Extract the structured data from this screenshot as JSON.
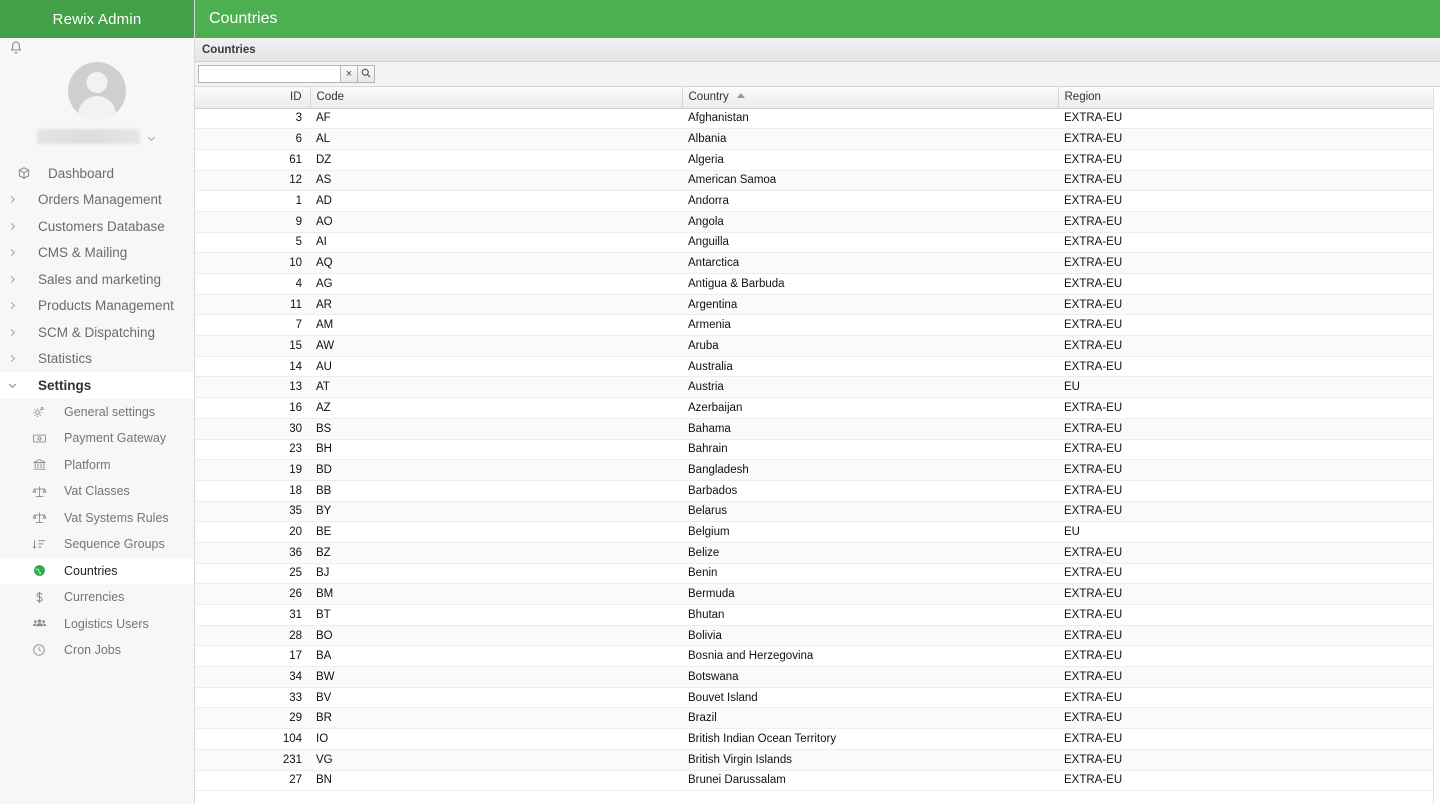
{
  "sidebar": {
    "brand": "Rewix Admin",
    "bell_icon": "bell-icon",
    "user": {
      "name_redacted": "",
      "caret_icon": "chevron-down-icon"
    },
    "menu": [
      {
        "label": "Dashboard",
        "icon": "box-icon",
        "arrow": "",
        "expanded": false
      },
      {
        "label": "Orders Management",
        "icon": "",
        "arrow": "chevron-right-icon",
        "expanded": false
      },
      {
        "label": "Customers Database",
        "icon": "",
        "arrow": "chevron-right-icon",
        "expanded": false
      },
      {
        "label": "CMS & Mailing",
        "icon": "",
        "arrow": "chevron-right-icon",
        "expanded": false
      },
      {
        "label": "Sales and marketing",
        "icon": "",
        "arrow": "chevron-right-icon",
        "expanded": false
      },
      {
        "label": "Products Management",
        "icon": "",
        "arrow": "chevron-right-icon",
        "expanded": false
      },
      {
        "label": "SCM & Dispatching",
        "icon": "",
        "arrow": "chevron-right-icon",
        "expanded": false
      },
      {
        "label": "Statistics",
        "icon": "",
        "arrow": "chevron-right-icon",
        "expanded": false
      },
      {
        "label": "Settings",
        "icon": "",
        "arrow": "chevron-down-icon",
        "expanded": true
      }
    ],
    "submenu": [
      {
        "label": "General settings",
        "icon": "gears-icon",
        "active": false
      },
      {
        "label": "Payment Gateway",
        "icon": "banknote-icon",
        "active": false
      },
      {
        "label": "Platform",
        "icon": "bank-icon",
        "active": false
      },
      {
        "label": "Vat Classes",
        "icon": "scales-icon",
        "active": false
      },
      {
        "label": "Vat Systems Rules",
        "icon": "scales-icon",
        "active": false
      },
      {
        "label": "Sequence Groups",
        "icon": "sort-list-icon",
        "active": false
      },
      {
        "label": "Countries",
        "icon": "globe-icon",
        "active": true
      },
      {
        "label": "Currencies",
        "icon": "dollar-icon",
        "active": false
      },
      {
        "label": "Logistics Users",
        "icon": "users-group-icon",
        "active": false
      },
      {
        "label": "Cron Jobs",
        "icon": "clock-icon",
        "active": false
      }
    ]
  },
  "topbar": {
    "title": "Countries"
  },
  "panel": {
    "header_title": "Countries",
    "search": {
      "value": "",
      "placeholder": "",
      "clear_label": "×",
      "clear_icon": "close-icon",
      "search_icon": "search-icon"
    }
  },
  "table": {
    "columns": [
      {
        "key": "id",
        "label": "ID",
        "align": "right",
        "sorted": ""
      },
      {
        "key": "code",
        "label": "Code",
        "align": "left",
        "sorted": ""
      },
      {
        "key": "country",
        "label": "Country",
        "align": "left",
        "sorted": "asc"
      },
      {
        "key": "region",
        "label": "Region",
        "align": "left",
        "sorted": ""
      }
    ],
    "rows": [
      {
        "id": "3",
        "code": "AF",
        "country": "Afghanistan",
        "region": "EXTRA-EU"
      },
      {
        "id": "6",
        "code": "AL",
        "country": "Albania",
        "region": "EXTRA-EU"
      },
      {
        "id": "61",
        "code": "DZ",
        "country": "Algeria",
        "region": "EXTRA-EU"
      },
      {
        "id": "12",
        "code": "AS",
        "country": "American Samoa",
        "region": "EXTRA-EU"
      },
      {
        "id": "1",
        "code": "AD",
        "country": "Andorra",
        "region": "EXTRA-EU"
      },
      {
        "id": "9",
        "code": "AO",
        "country": "Angola",
        "region": "EXTRA-EU"
      },
      {
        "id": "5",
        "code": "AI",
        "country": "Anguilla",
        "region": "EXTRA-EU"
      },
      {
        "id": "10",
        "code": "AQ",
        "country": "Antarctica",
        "region": "EXTRA-EU"
      },
      {
        "id": "4",
        "code": "AG",
        "country": "Antigua & Barbuda",
        "region": "EXTRA-EU"
      },
      {
        "id": "11",
        "code": "AR",
        "country": "Argentina",
        "region": "EXTRA-EU"
      },
      {
        "id": "7",
        "code": "AM",
        "country": "Armenia",
        "region": "EXTRA-EU"
      },
      {
        "id": "15",
        "code": "AW",
        "country": "Aruba",
        "region": "EXTRA-EU"
      },
      {
        "id": "14",
        "code": "AU",
        "country": "Australia",
        "region": "EXTRA-EU"
      },
      {
        "id": "13",
        "code": "AT",
        "country": "Austria",
        "region": "EU"
      },
      {
        "id": "16",
        "code": "AZ",
        "country": "Azerbaijan",
        "region": "EXTRA-EU"
      },
      {
        "id": "30",
        "code": "BS",
        "country": "Bahama",
        "region": "EXTRA-EU"
      },
      {
        "id": "23",
        "code": "BH",
        "country": "Bahrain",
        "region": "EXTRA-EU"
      },
      {
        "id": "19",
        "code": "BD",
        "country": "Bangladesh",
        "region": "EXTRA-EU"
      },
      {
        "id": "18",
        "code": "BB",
        "country": "Barbados",
        "region": "EXTRA-EU"
      },
      {
        "id": "35",
        "code": "BY",
        "country": "Belarus",
        "region": "EXTRA-EU"
      },
      {
        "id": "20",
        "code": "BE",
        "country": "Belgium",
        "region": "EU"
      },
      {
        "id": "36",
        "code": "BZ",
        "country": "Belize",
        "region": "EXTRA-EU"
      },
      {
        "id": "25",
        "code": "BJ",
        "country": "Benin",
        "region": "EXTRA-EU"
      },
      {
        "id": "26",
        "code": "BM",
        "country": "Bermuda",
        "region": "EXTRA-EU"
      },
      {
        "id": "31",
        "code": "BT",
        "country": "Bhutan",
        "region": "EXTRA-EU"
      },
      {
        "id": "28",
        "code": "BO",
        "country": "Bolivia",
        "region": "EXTRA-EU"
      },
      {
        "id": "17",
        "code": "BA",
        "country": "Bosnia and Herzegovina",
        "region": "EXTRA-EU"
      },
      {
        "id": "34",
        "code": "BW",
        "country": "Botswana",
        "region": "EXTRA-EU"
      },
      {
        "id": "33",
        "code": "BV",
        "country": "Bouvet Island",
        "region": "EXTRA-EU"
      },
      {
        "id": "29",
        "code": "BR",
        "country": "Brazil",
        "region": "EXTRA-EU"
      },
      {
        "id": "104",
        "code": "IO",
        "country": "British Indian Ocean Territory",
        "region": "EXTRA-EU"
      },
      {
        "id": "231",
        "code": "VG",
        "country": "British Virgin Islands",
        "region": "EXTRA-EU"
      },
      {
        "id": "27",
        "code": "BN",
        "country": "Brunei Darussalam",
        "region": "EXTRA-EU"
      }
    ]
  },
  "colors": {
    "topbar_green": "#4caf50",
    "brand_green": "#43a047",
    "active_green": "#2faa4c",
    "sidebar_bg": "#f7f7f7"
  }
}
